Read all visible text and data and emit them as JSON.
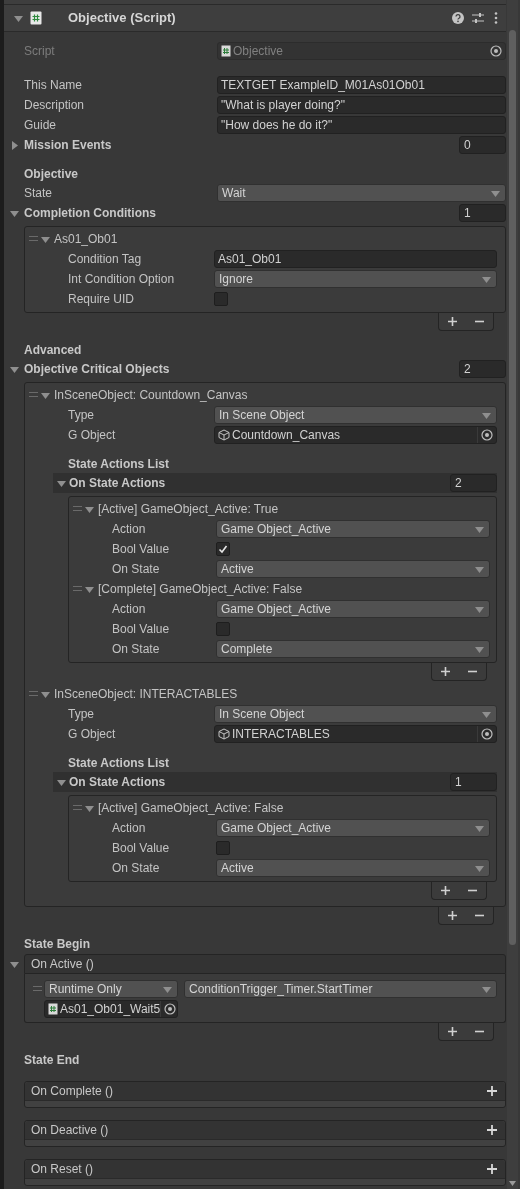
{
  "component": {
    "title": "Objective (Script)",
    "expanded": true
  },
  "fields": [
    {
      "kind": "script",
      "label": "Script",
      "value": "Objective",
      "disabled": true
    },
    {
      "kind": "text",
      "label": "This Name",
      "value": "TEXTGET ExampleID_M01As01Ob01"
    },
    {
      "kind": "text",
      "label": "Description",
      "value": "\"What is player doing?\""
    },
    {
      "kind": "text",
      "label": "Guide",
      "value": "\"How does he do it?\""
    },
    {
      "kind": "foldout",
      "label": "Mission Events",
      "count": "0",
      "expanded": false
    },
    {
      "kind": "header",
      "label": "Objective"
    },
    {
      "kind": "dropdown",
      "label": "State",
      "value": "Wait"
    },
    {
      "kind": "list",
      "label": "Completion Conditions",
      "count": "1",
      "expanded": true,
      "items": [
        {
          "title": "As01_Ob01",
          "expanded": true,
          "fields": [
            {
              "kind": "text",
              "label": "Condition Tag",
              "value": "As01_Ob01"
            },
            {
              "kind": "dropdown",
              "label": "Int Condition Option",
              "value": "Ignore"
            },
            {
              "kind": "checkbox",
              "label": "Require UID",
              "checked": false
            }
          ]
        }
      ]
    },
    {
      "kind": "header",
      "label": "Advanced"
    },
    {
      "kind": "list",
      "label": "Objective Critical Objects",
      "count": "2",
      "expanded": true,
      "items": [
        {
          "title": "InSceneObject: Countdown_Canvas",
          "expanded": true,
          "fields": [
            {
              "kind": "dropdown",
              "label": "Type",
              "value": "In Scene Object"
            },
            {
              "kind": "object",
              "label": "G Object",
              "value": "Countdown_Canvas",
              "disabled": false
            },
            {
              "kind": "header",
              "label": "State Actions List"
            },
            {
              "kind": "list",
              "label": "On State Actions",
              "count": "2",
              "expanded": true,
              "items": [
                {
                  "title": "[Active] GameObject_Active: True",
                  "expanded": true,
                  "fields": [
                    {
                      "kind": "dropdown",
                      "label": "Action",
                      "value": "Game Object_Active"
                    },
                    {
                      "kind": "checkbox",
                      "label": "Bool Value",
                      "checked": true
                    },
                    {
                      "kind": "dropdown",
                      "label": "On State",
                      "value": "Active"
                    }
                  ]
                },
                {
                  "title": "[Complete] GameObject_Active: False",
                  "expanded": true,
                  "fields": [
                    {
                      "kind": "dropdown",
                      "label": "Action",
                      "value": "Game Object_Active"
                    },
                    {
                      "kind": "checkbox",
                      "label": "Bool Value",
                      "checked": false
                    },
                    {
                      "kind": "dropdown",
                      "label": "On State",
                      "value": "Complete"
                    }
                  ]
                }
              ]
            }
          ]
        },
        {
          "title": "InSceneObject: INTERACTABLES",
          "expanded": true,
          "fields": [
            {
              "kind": "dropdown",
              "label": "Type",
              "value": "In Scene Object"
            },
            {
              "kind": "object",
              "label": "G Object",
              "value": "INTERACTABLES",
              "disabled": false
            },
            {
              "kind": "header",
              "label": "State Actions List"
            },
            {
              "kind": "list",
              "label": "On State Actions",
              "count": "1",
              "expanded": true,
              "items": [
                {
                  "title": "[Active] GameObject_Active: False",
                  "expanded": true,
                  "fields": [
                    {
                      "kind": "dropdown",
                      "label": "Action",
                      "value": "Game Object_Active"
                    },
                    {
                      "kind": "checkbox",
                      "label": "Bool Value",
                      "checked": false
                    },
                    {
                      "kind": "dropdown",
                      "label": "On State",
                      "value": "Active"
                    }
                  ]
                }
              ]
            }
          ]
        }
      ]
    },
    {
      "kind": "header",
      "label": "State Begin"
    },
    {
      "kind": "event",
      "label": "On Active ()",
      "calls": [
        {
          "mode": "Runtime Only",
          "function": "ConditionTrigger_Timer.StartTimer",
          "target": "As01_Ob01_Wait5"
        }
      ]
    },
    {
      "kind": "header",
      "label": "State End"
    },
    {
      "kind": "event",
      "label": "On Complete ()"
    },
    {
      "kind": "event",
      "label": "On Deactive ()"
    },
    {
      "kind": "event",
      "label": "On Reset ()"
    }
  ]
}
